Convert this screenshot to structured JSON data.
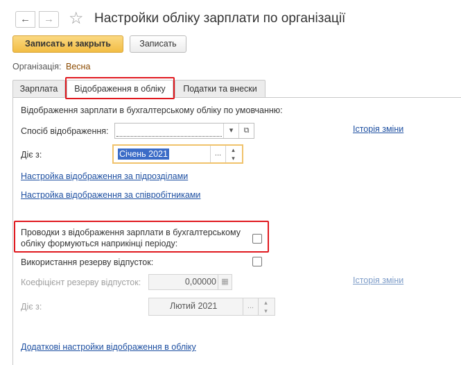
{
  "header": {
    "back_icon": "←",
    "forward_icon": "→",
    "favorite_icon": "☆",
    "title": "Настройки обліку зарплати по організації"
  },
  "toolbar": {
    "save_close_label": "Записать и закрыть",
    "save_label": "Записать"
  },
  "organization": {
    "label": "Організація:",
    "value": "Весна"
  },
  "tabs": [
    {
      "label": "Зарплата",
      "active": false
    },
    {
      "label": "Відображення в обліку",
      "active": true
    },
    {
      "label": "Податки та внески",
      "active": false
    }
  ],
  "section": {
    "heading": "Відображення зарплати в бухгалтерському обліку по умовчанню:",
    "method_label": "Спосіб відображення:",
    "method_value": "",
    "method_dropdown_icon": "▾",
    "method_open_icon": "⧉",
    "history_link": "Історія зміни",
    "valid_from_label": "Діє з:",
    "valid_from_value": "Січень 2021",
    "valid_from_picker_icon": "...",
    "spin_up_icon": "▴",
    "spin_down_icon": "▾",
    "link_subdivisions": "Настройка відображення за підрозділами",
    "link_employees": "Настройка відображення за співробітниками"
  },
  "postings": {
    "line1": "Проводки з відображення зарплати в бухгалтерському",
    "line2": "обліку формуються наприкінці періоду:",
    "checked": false
  },
  "reserve": {
    "usage_label": "Використання резерву відпусток:",
    "usage_checked": false,
    "coef_label": "Коефіцієнт резерву відпусток:",
    "coef_value": "0,00000",
    "calc_icon": "▦",
    "history_link": "Історія зміни",
    "valid_from_label": "Діє з:",
    "valid_from_value": "Лютий 2021",
    "valid_from_picker_icon": "...",
    "spin_up_icon": "▴",
    "spin_down_icon": "▾"
  },
  "footer_link": "Додаткові настройки відображення в обліку",
  "colors": {
    "accent": "#f2bd44",
    "link": "#1d4fa1",
    "highlight": "#e0181e",
    "org_value": "#8b4a00"
  }
}
